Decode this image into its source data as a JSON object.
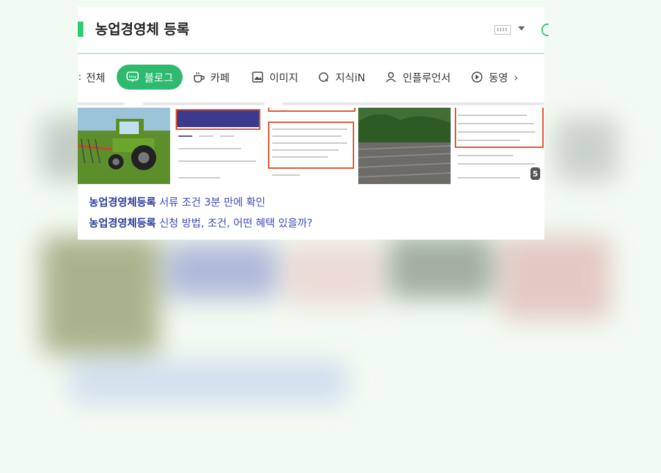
{
  "header": {
    "title": "농업경영체 등록"
  },
  "tabs": [
    {
      "label": "전체",
      "icon": "all-icon"
    },
    {
      "label": "블로그",
      "icon": "blog-icon",
      "active": true
    },
    {
      "label": "카페",
      "icon": "cafe-icon"
    },
    {
      "label": "이미지",
      "icon": "image-icon"
    },
    {
      "label": "지식iN",
      "icon": "knowledge-icon"
    },
    {
      "label": "인플루언서",
      "icon": "influencer-icon"
    },
    {
      "label": "동영",
      "icon": "video-icon"
    }
  ],
  "images": {
    "more_count": "5"
  },
  "results": [
    {
      "highlight": "농업경영체등록",
      "rest": " 서류 조건 3분 만에 확인"
    },
    {
      "highlight": "농업경영체등록",
      "rest": " 신청 방법, 조건, 어떤 혜택 있을까?"
    }
  ],
  "colors": {
    "accent": "#2dba6f",
    "link": "#3c4abd"
  }
}
